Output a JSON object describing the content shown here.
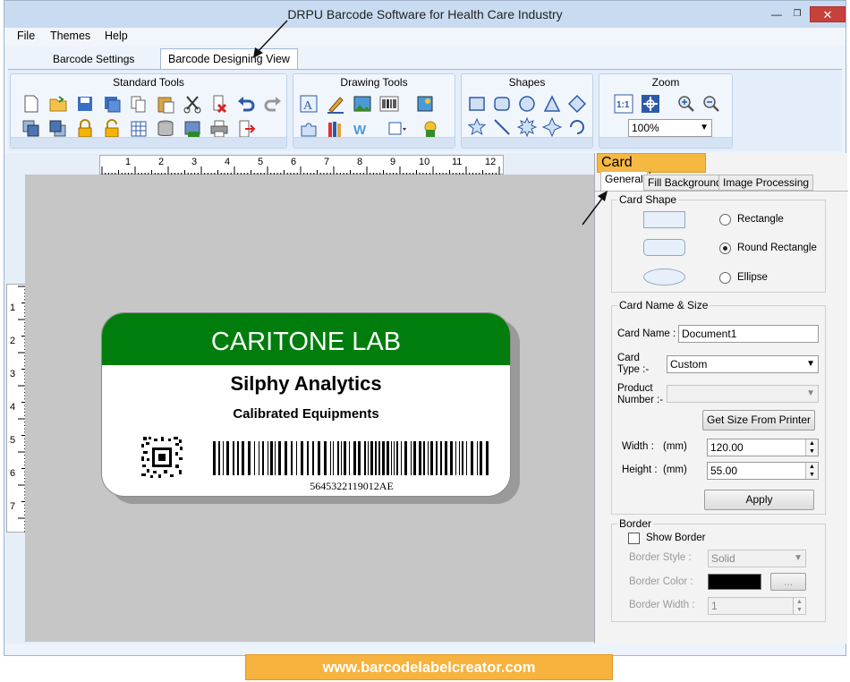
{
  "window": {
    "title": "DRPU Barcode Software for Health Care Industry"
  },
  "menu": [
    "File",
    "Themes",
    "Help"
  ],
  "ribbon_tabs": {
    "settings": "Barcode Settings",
    "designing": "Barcode Designing View"
  },
  "groups": {
    "standard": "Standard Tools",
    "drawing": "Drawing Tools",
    "shapes": "Shapes",
    "zoom": "Zoom",
    "zoom_value": "100%"
  },
  "ruler": {
    "h": [
      "1",
      "2",
      "3",
      "4",
      "5",
      "6",
      "7",
      "8",
      "9",
      "10",
      "11",
      "12"
    ],
    "v": [
      "1",
      "2",
      "3",
      "4",
      "5",
      "6",
      "7"
    ]
  },
  "card": {
    "header": "CARITONE LAB",
    "title": "Silphy Analytics",
    "subtitle": "Calibrated Equipments",
    "barcode_value": "5645322119012AE",
    "header_color": "#007d0c"
  },
  "props": {
    "title": "Card Properties",
    "tabs": {
      "general": "General",
      "fill": "Fill Background",
      "image": "Image Processing"
    },
    "card_shape": {
      "legend": "Card Shape",
      "rectangle": "Rectangle",
      "round_rectangle": "Round Rectangle",
      "ellipse": "Ellipse",
      "selected": "Round Rectangle"
    },
    "name_size": {
      "legend": "Card  Name & Size",
      "card_name_label": "Card Name :",
      "card_name_value": "Document1",
      "card_type_label1": "Card",
      "card_type_label2": "Type :-",
      "card_type_value": "Custom",
      "product_label1": "Product",
      "product_label2": "Number :-",
      "get_size_button": "Get Size From Printer",
      "width_label": "Width :",
      "width_unit": "(mm)",
      "width_value": "120.00",
      "height_label": "Height :",
      "height_unit": "(mm)",
      "height_value": "55.00",
      "apply_button": "Apply"
    },
    "border": {
      "legend": "Border",
      "show_border": "Show Border",
      "style_label": "Border Style :",
      "style_value": "Solid",
      "color_label": "Border Color :",
      "color_value": "#000000",
      "color_button": "...",
      "width_label": "Border Width :",
      "width_value": "1"
    }
  },
  "footer": "www.barcodelabelcreator.com"
}
